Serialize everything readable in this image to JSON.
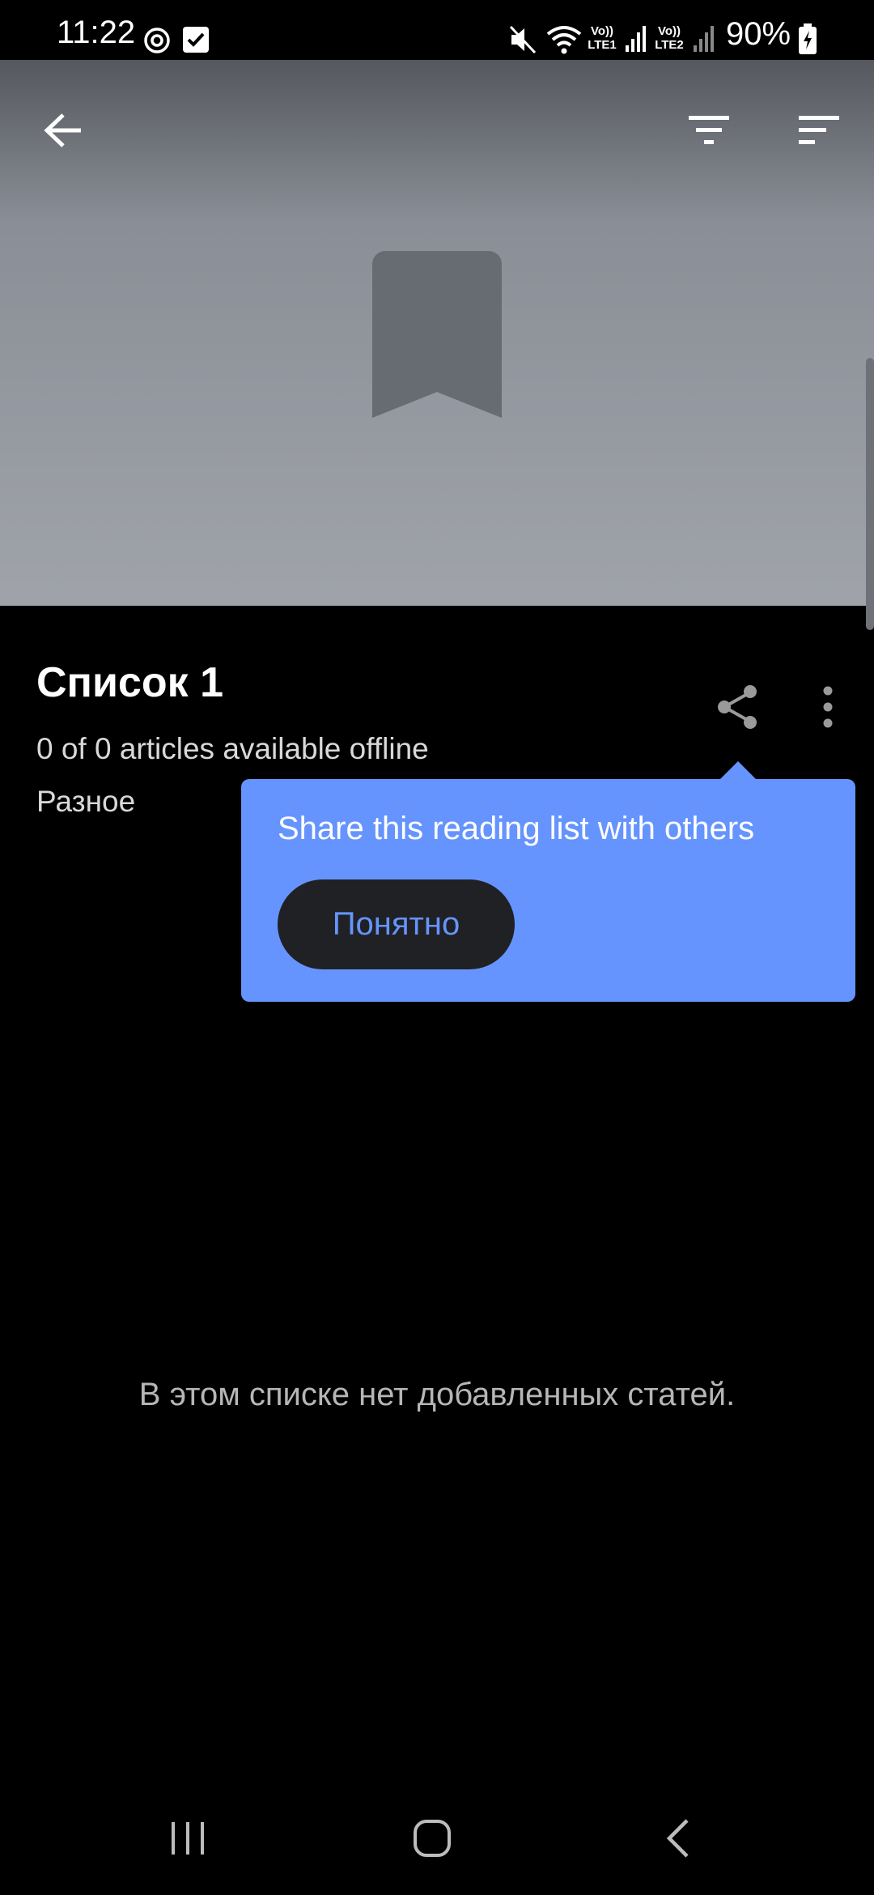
{
  "status_bar": {
    "time": "11:22",
    "battery": "90%",
    "icons": [
      "sync-icon",
      "check-box-icon",
      "mute-icon",
      "wifi-icon",
      "volte-lte1-icon",
      "signal-1-icon",
      "volte-lte2-icon",
      "signal-2-icon",
      "battery-charging-icon"
    ],
    "volte1_label_top": "Vo))",
    "volte1_label_bottom": "LTE1",
    "volte2_label_top": "Vo))",
    "volte2_label_bottom": "LTE2"
  },
  "toolbar": {
    "back_icon": "arrow-back-icon",
    "filter_icon": "filter-icon",
    "sort_icon": "sort-icon"
  },
  "header": {
    "art_icon": "bookmark-icon"
  },
  "list": {
    "title": "Список 1",
    "subtitle": "0 of 0 articles available offline",
    "category": "Разное",
    "share_icon": "share-icon",
    "more_icon": "more-vert-icon"
  },
  "tooltip": {
    "text": "Share this reading list with others",
    "button_label": "Понятно"
  },
  "empty_state": {
    "text": "В этом списке нет добавленных статей."
  },
  "nav_bar": {
    "recents_icon": "recents-icon",
    "home_icon": "home-icon",
    "back_icon": "nav-back-icon"
  },
  "colors": {
    "tooltip_background": "#6694fe",
    "tooltip_button_background": "#202124",
    "page_background": "#000000"
  }
}
